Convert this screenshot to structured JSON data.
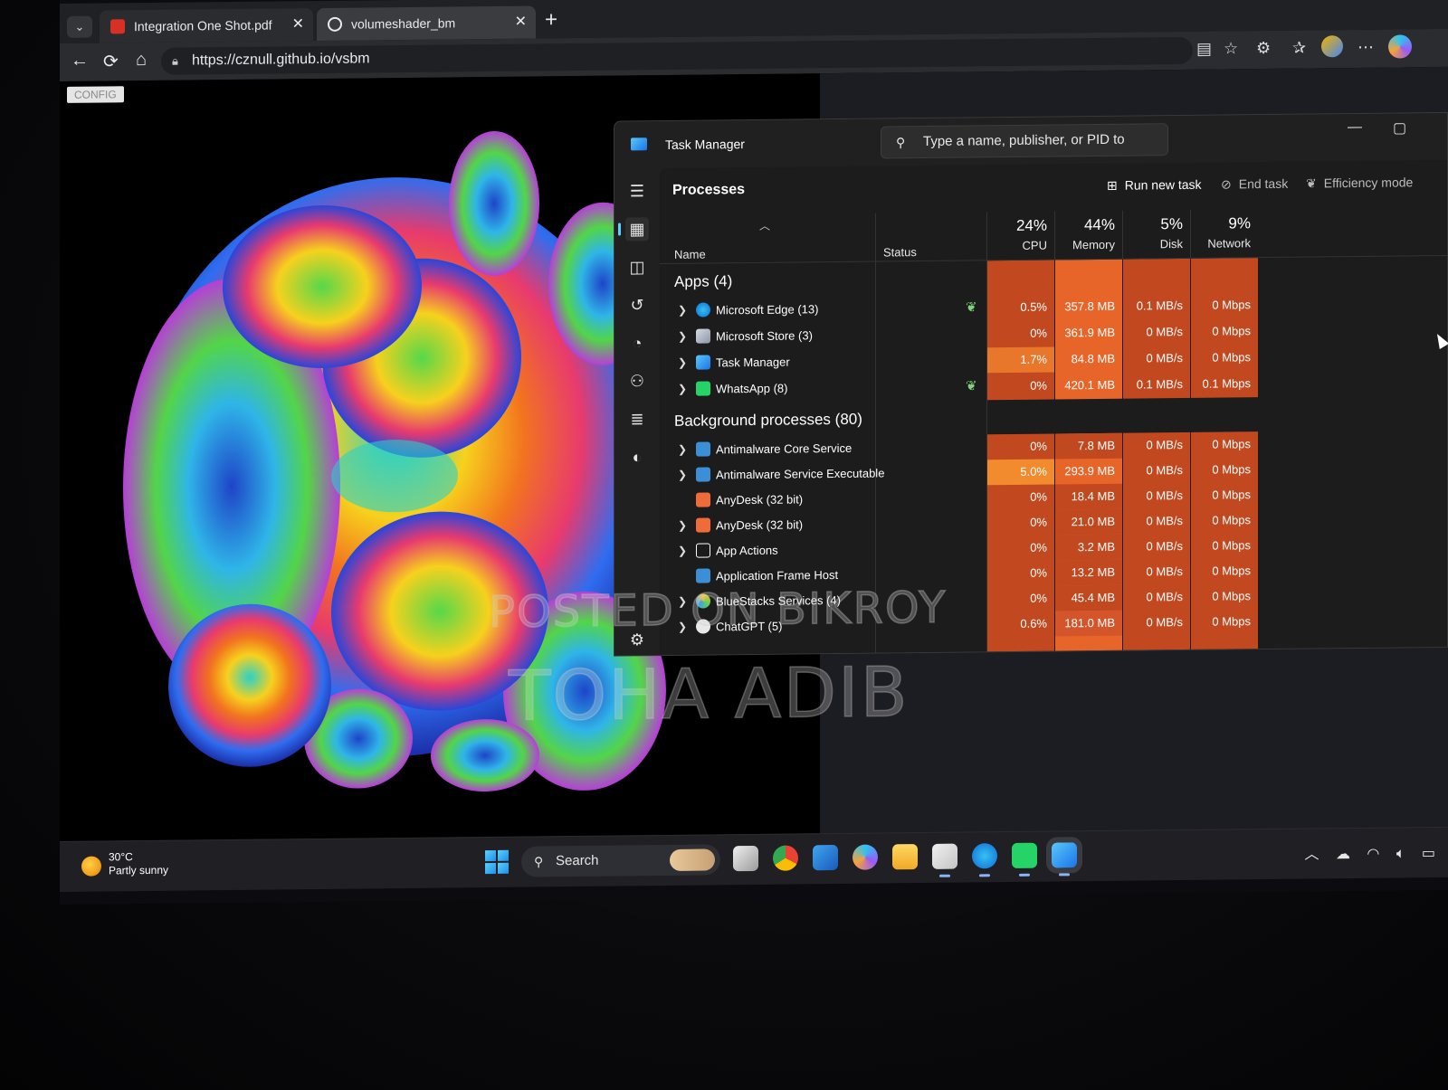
{
  "browser": {
    "tabs": [
      {
        "label": "Integration One Shot.pdf",
        "icon": "pdf-icon"
      },
      {
        "label": "volumeshader_bm",
        "icon": "globe-icon"
      }
    ],
    "new_tab_label": "+",
    "url": "https://cznull.github.io/vsbm",
    "toolbar_icons": [
      "reading-mode-icon",
      "favorite-star-icon",
      "extensions-icon",
      "favorites-icon",
      "profile-icon",
      "more-icon",
      "copilot-icon"
    ]
  },
  "page": {
    "config_label": "CONFIG"
  },
  "task_manager": {
    "title": "Task Manager",
    "search_placeholder": "Type a name, publisher, or PID to search",
    "section_title": "Processes",
    "commands": {
      "run_new_task": "Run new task",
      "end_task": "End task",
      "efficiency_mode": "Efficiency mode"
    },
    "columns": {
      "name": "Name",
      "status": "Status",
      "cpu_pct": "24%",
      "cpu": "CPU",
      "memory_pct": "44%",
      "memory": "Memory",
      "disk_pct": "5%",
      "disk": "Disk",
      "network_pct": "9%",
      "network": "Network"
    },
    "apps_group": "Apps (4)",
    "apps": [
      {
        "name": "Microsoft Edge (13)",
        "eco": true,
        "cpu": "0.5%",
        "memory": "357.8 MB",
        "disk": "0.1 MB/s",
        "network": "0 Mbps"
      },
      {
        "name": "Microsoft Store (3)",
        "eco": false,
        "cpu": "0%",
        "memory": "361.9 MB",
        "disk": "0 MB/s",
        "network": "0 Mbps"
      },
      {
        "name": "Task Manager",
        "eco": false,
        "cpu": "1.7%",
        "memory": "84.8 MB",
        "disk": "0 MB/s",
        "network": "0 Mbps"
      },
      {
        "name": "WhatsApp (8)",
        "eco": true,
        "cpu": "0%",
        "memory": "420.1 MB",
        "disk": "0.1 MB/s",
        "network": "0.1 Mbps"
      }
    ],
    "bg_group": "Background processes (80)",
    "background": [
      {
        "name": "Antimalware Core Service",
        "expand": true,
        "cpu": "0%",
        "memory": "7.8 MB",
        "disk": "0 MB/s",
        "network": "0 Mbps"
      },
      {
        "name": "Antimalware Service Executable",
        "expand": true,
        "cpu": "5.0%",
        "memory": "293.9 MB",
        "disk": "0 MB/s",
        "network": "0 Mbps"
      },
      {
        "name": "AnyDesk (32 bit)",
        "expand": false,
        "cpu": "0%",
        "memory": "18.4 MB",
        "disk": "0 MB/s",
        "network": "0 Mbps"
      },
      {
        "name": "AnyDesk (32 bit)",
        "expand": true,
        "cpu": "0%",
        "memory": "21.0 MB",
        "disk": "0 MB/s",
        "network": "0 Mbps"
      },
      {
        "name": "App Actions",
        "expand": true,
        "cpu": "0%",
        "memory": "3.2 MB",
        "disk": "0 MB/s",
        "network": "0 Mbps"
      },
      {
        "name": "Application Frame Host",
        "expand": false,
        "cpu": "0%",
        "memory": "13.2 MB",
        "disk": "0 MB/s",
        "network": "0 Mbps"
      },
      {
        "name": "BlueStacks Services (4)",
        "expand": true,
        "cpu": "0%",
        "memory": "45.4 MB",
        "disk": "0 MB/s",
        "network": "0 Mbps"
      },
      {
        "name": "ChatGPT (5)",
        "expand": true,
        "cpu": "0.6%",
        "memory": "181.0 MB",
        "disk": "0 MB/s",
        "network": "0 Mbps"
      }
    ]
  },
  "watermark": {
    "line1": "POSTED ON BIKROY",
    "line2": "TOHA ADIB"
  },
  "taskbar": {
    "temperature": "30°C",
    "condition": "Partly sunny",
    "search_label": "Search",
    "apps": [
      "task-view-icon",
      "chrome-icon",
      "word-icon",
      "copilot-icon",
      "file-explorer-icon",
      "store-icon",
      "edge-icon",
      "whatsapp-icon",
      "task-manager-icon"
    ],
    "tray": [
      "chevron-up-icon",
      "onedrive-icon",
      "wifi-icon",
      "volume-icon",
      "battery-icon"
    ]
  },
  "colors": {
    "cpu_heat_low": "#c2491f",
    "cpu_heat_mid": "#e8762b",
    "mem_heat": "#e8652a",
    "accent": "#60cdff"
  }
}
